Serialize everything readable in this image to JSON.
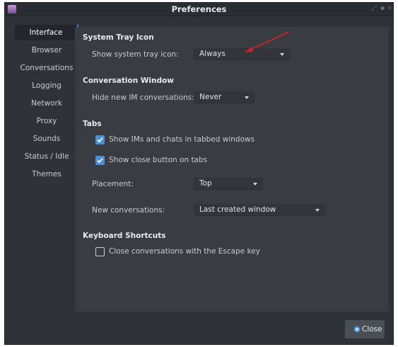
{
  "window": {
    "title": "Preferences",
    "controls": [
      "minimize-icon",
      "maximize-icon",
      "close-icon"
    ]
  },
  "sidebar": {
    "items": [
      {
        "label": "Interface",
        "active": true
      },
      {
        "label": "Browser"
      },
      {
        "label": "Conversations"
      },
      {
        "label": "Logging"
      },
      {
        "label": "Network"
      },
      {
        "label": "Proxy"
      },
      {
        "label": "Sounds"
      },
      {
        "label": "Status / Idle"
      },
      {
        "label": "Themes"
      }
    ]
  },
  "tray": {
    "heading": "System Tray Icon",
    "label": "Show system tray icon:",
    "value": "Always"
  },
  "conv_window": {
    "heading": "Conversation Window",
    "label": "Hide new IM conversations:",
    "value": "Never"
  },
  "tabs": {
    "heading": "Tabs",
    "check1_label": "Show IMs and chats in tabbed windows",
    "check1_checked": true,
    "check2_label": "Show close button on tabs",
    "check2_checked": true,
    "placement_label": "Placement:",
    "placement_value": "Top",
    "newconv_label": "New conversations:",
    "newconv_value": "Last created window"
  },
  "shortcuts": {
    "heading": "Keyboard Shortcuts",
    "escape_label": "Close conversations with the Escape key",
    "escape_checked": false
  },
  "buttons": {
    "close_label": "Close"
  },
  "colors": {
    "accent": "#4a90d9",
    "annotation_arrow": "#c8252b",
    "window_bg": "#2f3337",
    "content_bg": "#393d42"
  }
}
